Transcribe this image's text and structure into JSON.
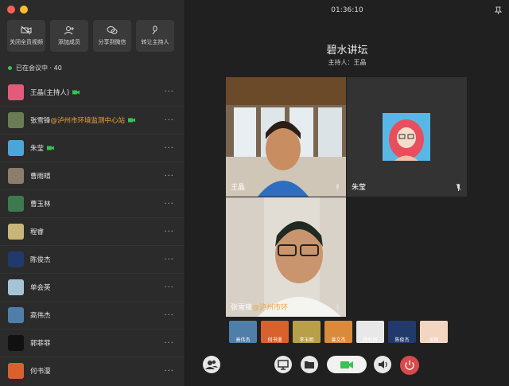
{
  "sidebar": {
    "actions": [
      {
        "label": "关闭全员视频",
        "icon": "camera-off-icon"
      },
      {
        "label": "添加成员",
        "icon": "add-user-icon"
      },
      {
        "label": "分享到微信",
        "icon": "wechat-icon"
      },
      {
        "label": "转让主持人",
        "icon": "transfer-host-icon"
      }
    ],
    "count_label": "已在会议中 · 40",
    "participants": [
      {
        "name": "王晶(主持人)",
        "org": "",
        "camera": true,
        "color": "#e45a7a"
      },
      {
        "name": "张雪锋",
        "org": "@泸州市环境监测中心站",
        "camera": true,
        "color": "#6b7c55"
      },
      {
        "name": "朱莹",
        "org": "",
        "camera": true,
        "color": "#4aa6d8"
      },
      {
        "name": "曹雨晴",
        "org": "",
        "camera": false,
        "color": "#8c7d6d"
      },
      {
        "name": "曹玉林",
        "org": "",
        "camera": false,
        "color": "#3d7a4d"
      },
      {
        "name": "程睿",
        "org": "",
        "camera": false,
        "color": "#c7b57a"
      },
      {
        "name": "陈俊杰",
        "org": "",
        "camera": false,
        "color": "#213a6b"
      },
      {
        "name": "单会英",
        "org": "",
        "camera": false,
        "color": "#a7c4d6"
      },
      {
        "name": "高伟杰",
        "org": "",
        "camera": false,
        "color": "#4f7fa8"
      },
      {
        "name": "郭菲菲",
        "org": "",
        "camera": false,
        "color": "#111111"
      },
      {
        "name": "何书漫",
        "org": "",
        "camera": false,
        "color": "#d8612e"
      }
    ]
  },
  "main": {
    "clock": "01:36:10",
    "title": "碧水讲坛",
    "host_line": "主持人：王晶",
    "tiles": {
      "wangjing": {
        "name": "王晶"
      },
      "zhuying": {
        "name": "朱莹"
      },
      "zhangxuefeng": {
        "name": "张雪锋",
        "org": "@泸州市环"
      }
    },
    "thumbnails": [
      {
        "label": "高伟杰",
        "color": "#4f7fa8"
      },
      {
        "label": "何书漫",
        "color": "#d8612e"
      },
      {
        "label": "李玉明",
        "color": "#b8a04a"
      },
      {
        "label": "曾文杰",
        "color": "#d98a3b"
      },
      {
        "label": "杨秋雨",
        "color": "#e8e8e8"
      },
      {
        "label": "陈俊杰",
        "color": "#213a6b"
      },
      {
        "label": "吴丽",
        "color": "#f2d6c2"
      }
    ]
  },
  "colors": {
    "accent_green": "#39c352",
    "end_red": "#e24a4a",
    "org_orange": "#f2a33a"
  }
}
